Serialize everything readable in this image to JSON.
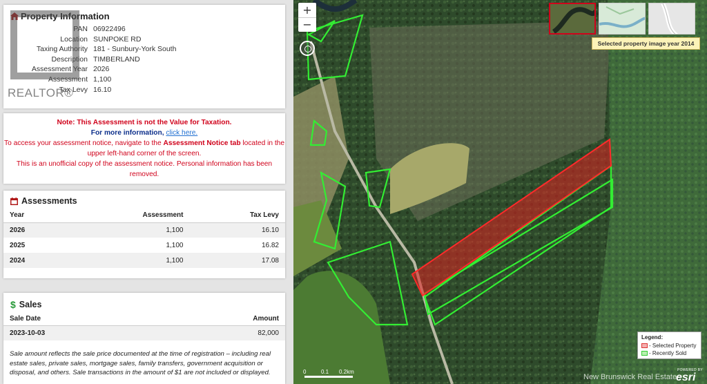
{
  "property": {
    "title": "Property Information",
    "rows": [
      {
        "label": "PAN",
        "value": "06922496"
      },
      {
        "label": "Location",
        "value": "SUNPOKE RD"
      },
      {
        "label": "Taxing Authority",
        "value": "181 - Sunbury-York South"
      },
      {
        "label": "Description",
        "value": "TIMBERLAND"
      },
      {
        "label": "Assessment Year",
        "value": "2026"
      },
      {
        "label": "Assessment",
        "value": "1,100"
      },
      {
        "label": "Tax Levy",
        "value": "16.10"
      }
    ],
    "watermark": "REALTOR®"
  },
  "note": {
    "line1": "Note: This Assessment is not the Value for Taxation.",
    "line2_prefix": "For more information, ",
    "line2_link": "click here.",
    "line3_a": "To access your assessment notice, navigate to the ",
    "line3_b": "Assessment Notice tab",
    "line3_c": " located in the upper left-hand corner of the screen.",
    "line4": "This is an unofficial copy of the assessment notice. Personal information has been removed."
  },
  "assessments": {
    "title": "Assessments",
    "headers": [
      "Year",
      "Assessment",
      "Tax Levy"
    ],
    "rows": [
      [
        "2026",
        "1,100",
        "16.10"
      ],
      [
        "2025",
        "1,100",
        "16.82"
      ],
      [
        "2024",
        "1,100",
        "17.08"
      ]
    ]
  },
  "sales": {
    "title": "Sales",
    "headers": [
      "Sale Date",
      "Amount"
    ],
    "rows": [
      [
        "2023-10-03",
        "82,000"
      ]
    ],
    "note": "Sale amount reflects the sale price documented at the time of registration – including real estate sales, private sales, mortgage sales, family transfers, government acquisition or disposal, and others. Sale transactions in the amount of $1 are not included or displayed."
  },
  "map": {
    "zoom_in": "+",
    "zoom_out": "−",
    "year_label": "Selected property image year 2014",
    "legend_title": "Legend:",
    "legend_selected": "- Selected Property",
    "legend_sold": "- Recently Sold",
    "scale_0": "0",
    "scale_1": "0.1",
    "scale_2": "0.2km",
    "credit": "New Brunswick Real Estate",
    "esri_powered": "POWERED BY",
    "esri_logo": "esri"
  },
  "colors": {
    "selected": "#e02020",
    "sold": "#33ee33",
    "note_red": "#d0021b",
    "note_blue": "#0b2e8a"
  }
}
